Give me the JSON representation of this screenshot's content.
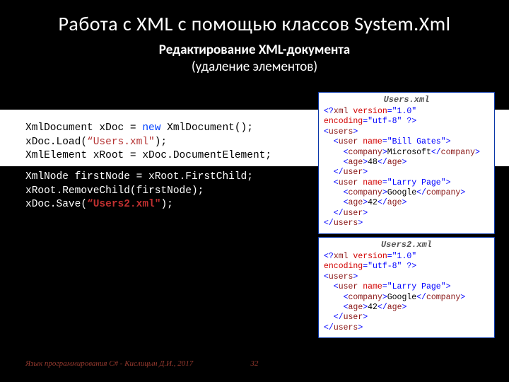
{
  "title": "Работа с XML с помощью классов System.Xml",
  "subtitle": "Редактирование XML-документа",
  "subsub": "(удаление элементов)",
  "code": {
    "l1a": "XmlDocument xDoc = ",
    "l1new": "new",
    "l1b": " XmlDocument();",
    "l2a": "xDoc.Load(",
    "l2s": "“Users.xml\"",
    "l2b": ");",
    "l3": "XmlElement xRoot = xDoc.DocumentElement;",
    "l4": "XmlNode firstNode = xRoot.FirstChild;",
    "l5": "xRoot.RemoveChild(firstNode);",
    "l6a": "xDoc.Save(",
    "l6s": "“Users2.xml\"",
    "l6b": ");"
  },
  "box1": {
    "hdr": "Users.xml",
    "l1a": "<?",
    "l1b": "xml",
    "l1c": " version",
    "l1d": "=",
    "l1e": "\"1.0\"",
    "l1f": " encoding",
    "l1g": "=",
    "l1h": "\"utf-8\"",
    "l1i": " ?>",
    "l2a": "<",
    "l2b": "users",
    "l2c": ">",
    "l3a": "  <",
    "l3b": "user",
    "l3c": " name",
    "l3d": "=",
    "l3e": "\"Bill Gates\"",
    "l3f": ">",
    "l4a": "    <",
    "l4b": "company",
    "l4c": ">",
    "l4d": "Microsoft",
    "l4e": "</",
    "l4f": "company",
    "l4g": ">",
    "l5a": "    <",
    "l5b": "age",
    "l5c": ">",
    "l5d": "48",
    "l5e": "</",
    "l5f": "age",
    "l5g": ">",
    "l6a": "  </",
    "l6b": "user",
    "l6c": ">",
    "l7a": "  <",
    "l7b": "user",
    "l7c": " name",
    "l7d": "=",
    "l7e": "\"Larry Page\"",
    "l7f": ">",
    "l8a": "    <",
    "l8b": "company",
    "l8c": ">",
    "l8d": "Google",
    "l8e": "</",
    "l8f": "company",
    "l8g": ">",
    "l9a": "    <",
    "l9b": "age",
    "l9c": ">",
    "l9d": "42",
    "l9e": "</",
    "l9f": "age",
    "l9g": ">",
    "l10a": "  </",
    "l10b": "user",
    "l10c": ">",
    "l11a": "</",
    "l11b": "users",
    "l11c": ">"
  },
  "box2": {
    "hdr": "Users2.xml",
    "l1a": "<?",
    "l1b": "xml",
    "l1c": " version",
    "l1d": "=",
    "l1e": "\"1.0\"",
    "l1f": " encoding",
    "l1g": "=",
    "l1h": "\"utf-8\"",
    "l1i": " ?>",
    "l2a": "<",
    "l2b": "users",
    "l2c": ">",
    "l3a": "  <",
    "l3b": "user",
    "l3c": " name",
    "l3d": "=",
    "l3e": "\"Larry Page\"",
    "l3f": ">",
    "l4a": "    <",
    "l4b": "company",
    "l4c": ">",
    "l4d": "Google",
    "l4e": "</",
    "l4f": "company",
    "l4g": ">",
    "l5a": "    <",
    "l5b": "age",
    "l5c": ">",
    "l5d": "42",
    "l5e": "</",
    "l5f": "age",
    "l5g": ">",
    "l6a": "  </",
    "l6b": "user",
    "l6c": ">",
    "l7a": "</",
    "l7b": "users",
    "l7c": ">"
  },
  "footer": "Язык программирования C# - Кислицын Д.И., 2017",
  "pagenum": "32"
}
